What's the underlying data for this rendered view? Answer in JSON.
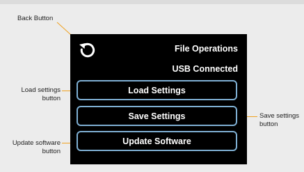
{
  "device": {
    "title": "File Operations",
    "status": "USB Connected",
    "buttons": {
      "load": "Load Settings",
      "save": "Save Settings",
      "update": "Update Software"
    },
    "back_icon": "back-icon",
    "accent_color": "#7fb0d4",
    "leader_color": "#f0a11f"
  },
  "annotations": {
    "back_button": "Back Button",
    "load_line1": "Load settings",
    "load_line2": "button",
    "save_line1": "Save settings",
    "save_line2": "button",
    "update_line1": "Update software",
    "update_line2": "button"
  }
}
